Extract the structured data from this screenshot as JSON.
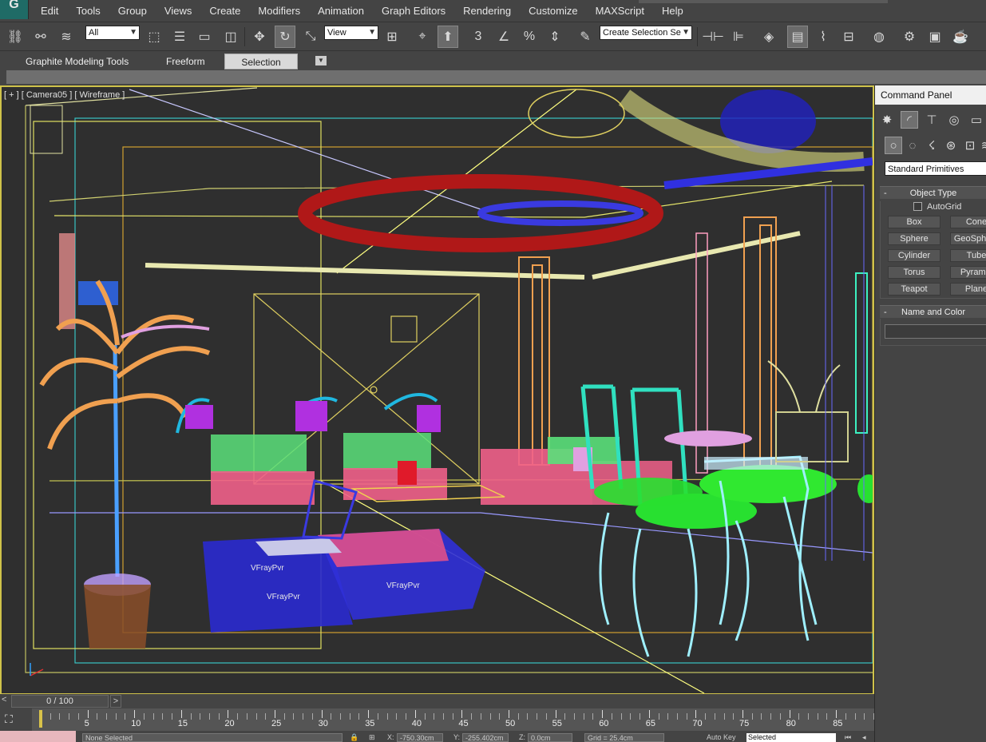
{
  "app": {
    "logo": "G"
  },
  "menu": [
    "Edit",
    "Tools",
    "Group",
    "Views",
    "Create",
    "Modifiers",
    "Animation",
    "Graph Editors",
    "Rendering",
    "Customize",
    "MAXScript",
    "Help"
  ],
  "toolbar": {
    "selection_filter": "All",
    "reference_coord": "View",
    "snap_labels": {
      "snap3": "3",
      "percent": "%"
    },
    "named_selection_placeholder": "Create Selection Se"
  },
  "ribbon": {
    "tabs": [
      {
        "label": "Graphite Modeling Tools",
        "active": false
      },
      {
        "label": "Freeform",
        "active": false
      },
      {
        "label": "Selection",
        "active": true
      }
    ]
  },
  "viewport": {
    "label": "[ + ] [ Camera05 ] [ Wireframe ]",
    "active_border_color": "#cfc24a",
    "background": "#2f2f2f",
    "scene_labels": [
      "VFrayPvr",
      "VFrayPvr",
      "VFrayPvr"
    ]
  },
  "command_panel": {
    "title": "Command Panel",
    "tabs": [
      "create-icon",
      "modify-icon",
      "hierarchy-icon",
      "motion-icon",
      "display-icon"
    ],
    "categories": [
      "geometry-icon",
      "shapes-icon",
      "lights-icon",
      "cameras-icon",
      "helpers-icon",
      "spacewarps-icon"
    ],
    "primitive_type": "Standard Primitives",
    "object_type": {
      "header": "Object Type",
      "autogrid_label": "AutoGrid",
      "buttons": [
        "Box",
        "Cone",
        "Sphere",
        "GeoSphere",
        "Cylinder",
        "Tube",
        "Torus",
        "Pyramid",
        "Teapot",
        "Plane"
      ]
    },
    "name_and_color": {
      "header": "Name and Color",
      "name_value": ""
    }
  },
  "time_slider": {
    "label": "0 / 100",
    "prev": "<",
    "next": ">"
  },
  "track_bar": {
    "ticks": [
      "5",
      "10",
      "15",
      "20",
      "25",
      "30",
      "35",
      "40",
      "45",
      "50",
      "55",
      "60",
      "65",
      "70",
      "75",
      "80",
      "85"
    ],
    "current_frame": 0
  },
  "status_bar": {
    "selection_text": "None Selected",
    "x_value": "-750.30cm",
    "y_value": "-255.402cm",
    "z_value": "0.0cm",
    "grid_text": "Grid = 25.4cm",
    "auto_key": "Auto Key",
    "key_mode": "Selected",
    "x_label": "X:",
    "y_label": "Y:",
    "z_label": "Z:"
  }
}
